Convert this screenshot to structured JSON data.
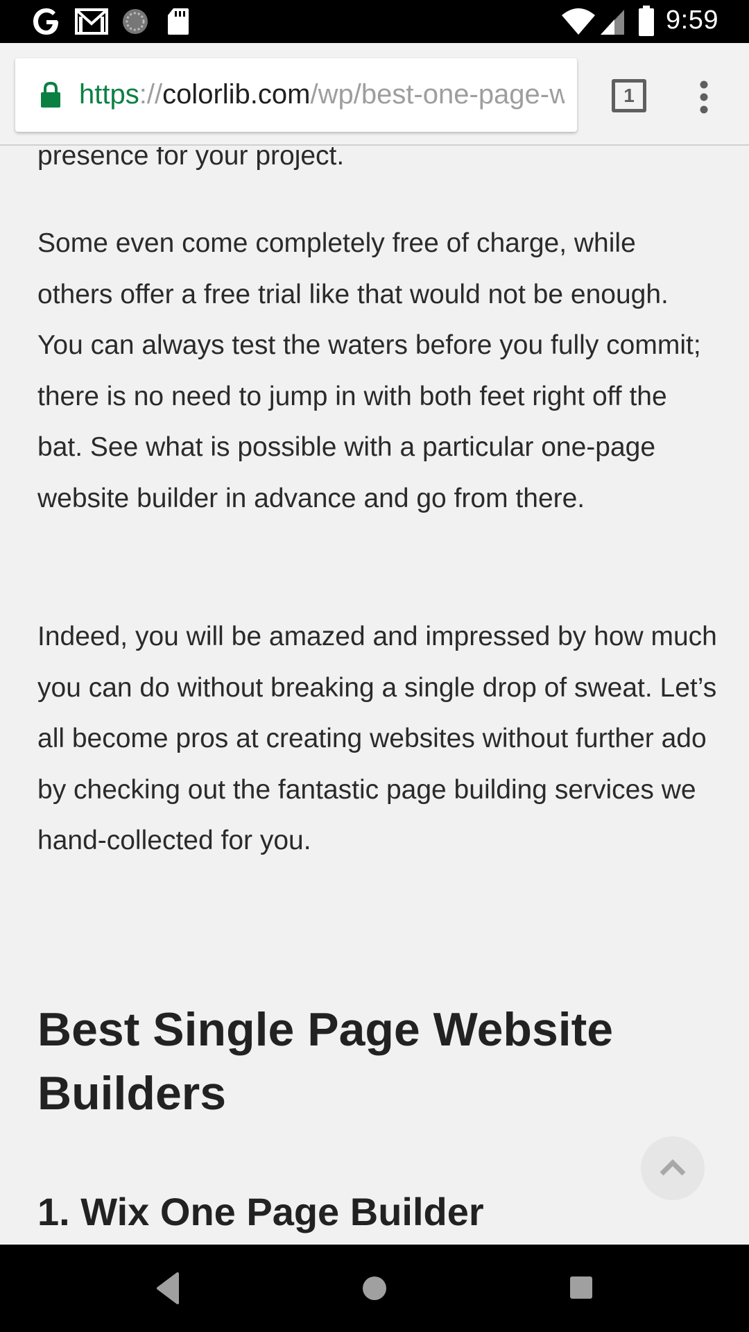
{
  "status_bar": {
    "time": "9:59",
    "left_icons": [
      "google-icon",
      "gmail-icon",
      "sync-icon",
      "sd-card-icon"
    ],
    "right_icons": [
      "wifi-icon",
      "signal-icon",
      "battery-icon"
    ]
  },
  "toolbar": {
    "url": {
      "scheme": "https",
      "separator": "://",
      "host": "colorlib.com",
      "path": "/wp/best-one-page-website-builders/"
    },
    "tab_count": "1"
  },
  "article": {
    "partial_line": "presence for your project.",
    "paragraph_1": "Some even come completely free of charge, while others offer a free trial like that would not be enough. You can always test the waters before you fully commit; there is no need to jump in with both feet right off the bat. See what is possible with a particular one-page website builder in advance and go from there.",
    "paragraph_2": "Indeed, you will be amazed and impressed by how much you can do without breaking a single drop of sweat. Let’s all become pros at creating websites without further ado by checking out the fantastic page building services we hand-collected for you.",
    "heading": "Best Single Page Website Builders",
    "subheading": "1. Wix One Page Builder"
  },
  "colors": {
    "secure_green": "#0b8043",
    "background": "#f1f1f1",
    "text": "#2a2a2a"
  }
}
